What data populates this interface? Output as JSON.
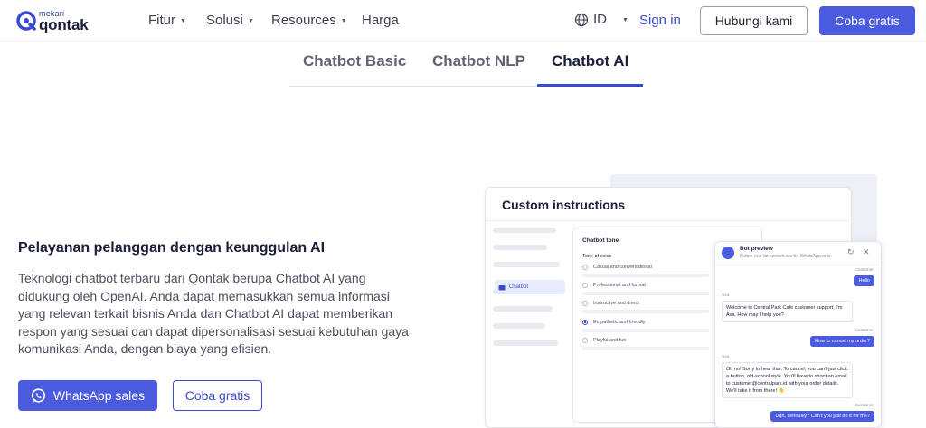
{
  "brand": {
    "top": "mekari",
    "main": "qontak",
    "color": "#3b4bd0"
  },
  "nav": {
    "menus": [
      "Fitur",
      "Solusi",
      "Resources",
      "Harga"
    ],
    "language": "ID",
    "signin": "Sign in",
    "contact": "Hubungi kami",
    "trial": "Coba gratis"
  },
  "tabs": [
    {
      "label": "Chatbot Basic",
      "active": false
    },
    {
      "label": "Chatbot NLP",
      "active": false
    },
    {
      "label": "Chatbot AI",
      "active": true
    }
  ],
  "content": {
    "heading": "Pelayanan pelanggan dengan keunggulan AI",
    "paragraph": "Teknologi chatbot terbaru dari Qontak berupa Chatbot AI yang didukung oleh OpenAI. Anda dapat memasukkan semua informasi yang relevan terkait bisnis Anda dan Chatbot AI dapat memberikan respon yang sesuai dan dapat dipersonalisasi sesuai kebutuhan gaya komunikasi Anda, dengan biaya yang efisien.",
    "whatsapp_button": "WhatsApp sales",
    "trial_button": "Coba gratis"
  },
  "illustration": {
    "card_title": "Custom instructions",
    "sidebar_active": "Chatbot",
    "tone_title": "Chatbot tone",
    "tone_subtitle": "Tone of voice",
    "options": [
      {
        "label": "Casual and conversational",
        "selected": false
      },
      {
        "label": "Professional and formal",
        "selected": false
      },
      {
        "label": "Instructive and direct",
        "selected": false
      },
      {
        "label": "Empathetic and friendly",
        "selected": true
      },
      {
        "label": "Playful and fun",
        "selected": false
      }
    ],
    "chat": {
      "title": "Bot preview",
      "subtitle": "Button and list content are for WhatsApp only",
      "messages": [
        {
          "from": "Customer",
          "side": "right",
          "text": "Hello"
        },
        {
          "from": "Ava",
          "side": "left",
          "text": "Welcome to Central Park Cafe customer support, I'm Ava. How may I help you?"
        },
        {
          "from": "Customer",
          "side": "right",
          "text": "How to cancel my order?"
        },
        {
          "from": "Ava",
          "side": "left",
          "text": "Oh no! Sorry to hear that. To cancel, you can't just click a button, old-school style. You'll have to shoot an email to customer@centralpark.id with your order details. We'll take it from there! 👋"
        },
        {
          "from": "Customer",
          "side": "right",
          "text": "Ugh, seriously? Can't you just do it for me?"
        }
      ]
    }
  }
}
